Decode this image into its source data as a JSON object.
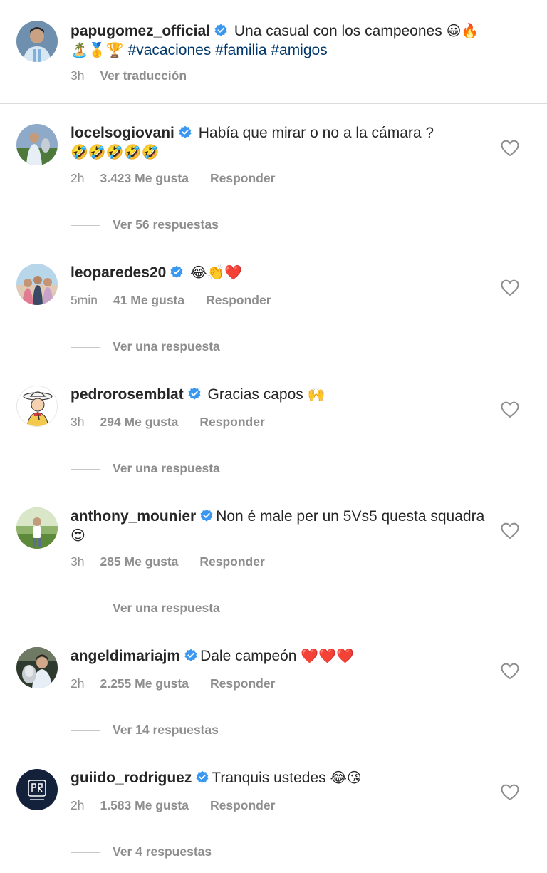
{
  "caption": {
    "username": "papugomez_official",
    "text": "Una casual con los campeones",
    "emojis": "😀🔥",
    "emojis_line2": "🏝️🥇🏆",
    "hashtags": "#vacaciones #familia #amigos",
    "time": "3h",
    "translate": "Ver traducción"
  },
  "comments": [
    {
      "username": "locelsogiovani",
      "text": "Había que mirar o no a la cámara ?",
      "emojis": "🤣🤣🤣🤣🤣",
      "time": "2h",
      "likes": "3.423 Me gusta",
      "reply": "Responder",
      "replies": "Ver 56 respuestas"
    },
    {
      "username": "leoparedes20",
      "text": "",
      "emojis": "😂👏❤️",
      "time": "5min",
      "likes": "41 Me gusta",
      "reply": "Responder",
      "replies": "Ver una respuesta"
    },
    {
      "username": "pedrorosemblat",
      "text": "Gracias capos",
      "emojis": "🙌",
      "time": "3h",
      "likes": "294 Me gusta",
      "reply": "Responder",
      "replies": "Ver una respuesta"
    },
    {
      "username": "anthony_mounier",
      "text": "Non é male per un 5Vs5 questa squadra",
      "emojis": "😍",
      "time": "3h",
      "likes": "285 Me gusta",
      "reply": "Responder",
      "replies": "Ver una respuesta"
    },
    {
      "username": "angeldimariajm",
      "text": "Dale campeón",
      "emojis": "❤️❤️❤️",
      "time": "2h",
      "likes": "2.255 Me gusta",
      "reply": "Responder",
      "replies": "Ver 14 respuestas"
    },
    {
      "username": "guiido_rodriguez",
      "text": "Tranquis ustedes",
      "emojis": "😂😘",
      "time": "2h",
      "likes": "1.583 Me gusta",
      "reply": "Responder",
      "replies": "Ver 4 respuestas"
    }
  ],
  "icons": {
    "verified": "verified-badge-icon",
    "like": "heart-outline-icon"
  },
  "colors": {
    "verified": "#3897f0",
    "hashtag": "#00376b",
    "meta": "#8e8e8e",
    "text": "#262626"
  }
}
